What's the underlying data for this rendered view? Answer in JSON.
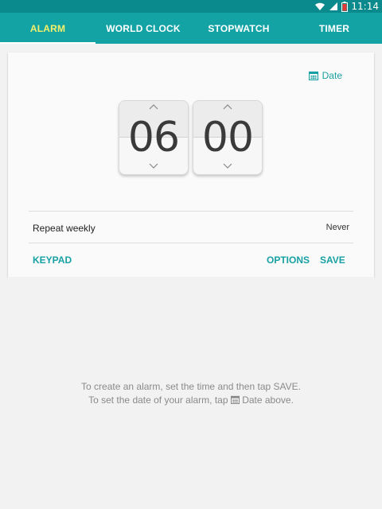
{
  "status_bar": {
    "time": "11:14"
  },
  "tabs": [
    {
      "label": "ALARM",
      "active": true
    },
    {
      "label": "WORLD CLOCK",
      "active": false
    },
    {
      "label": "STOPWATCH",
      "active": false
    },
    {
      "label": "TIMER",
      "active": false
    }
  ],
  "alarm_editor": {
    "date_label": "Date",
    "hours": "06",
    "minutes": "00",
    "repeat_label": "Repeat weekly",
    "repeat_value": "Never",
    "keypad_label": "KEYPAD",
    "options_label": "OPTIONS",
    "save_label": "SAVE"
  },
  "empty_hint": {
    "line1": "To create an alarm, set the time and then tap SAVE.",
    "line2_before": "To set the date of your alarm, tap",
    "line2_after": "Date above."
  },
  "colors": {
    "accent": "#17a0a3",
    "tab_bar": "#13a3a5",
    "status_bar": "#0a8a8c",
    "active_tab": "#f4f06a"
  },
  "icons": [
    "wifi-icon",
    "signal-icon",
    "battery-icon",
    "calendar-icon",
    "chevron-up-icon",
    "chevron-down-icon"
  ]
}
